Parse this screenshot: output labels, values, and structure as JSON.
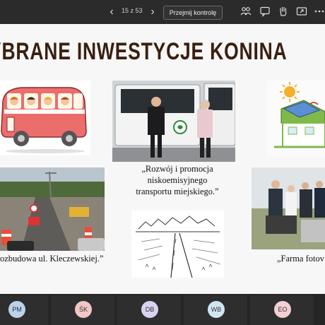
{
  "toolbar": {
    "prev_label": "‹",
    "next_label": "›",
    "page_counter": "15 z 53",
    "take_control_label": "Przejmij kontrolę",
    "icons": [
      "people-icon",
      "chat-icon",
      "raise-hand-icon",
      "share-icon",
      "more-icon"
    ]
  },
  "slide": {
    "title": "YBRANE INWESTYCJE KONINA",
    "captions": {
      "transport": "„Rozwój i promocja niskoemisyjnego transportu miejskiego.”",
      "road": "ozbudowa ul. Kleczewskiej.”",
      "farm": "„Farma fotov"
    }
  },
  "participants": [
    {
      "initials": "PM",
      "color": "#b9d3ea"
    },
    {
      "initials": "ŚK",
      "color": "#f2c6c6"
    },
    {
      "initials": "DB",
      "color": "#d9d2f0"
    },
    {
      "initials": "WB",
      "color": "#cfe6f2"
    },
    {
      "initials": "EO",
      "color": "#f3cfd6"
    }
  ]
}
